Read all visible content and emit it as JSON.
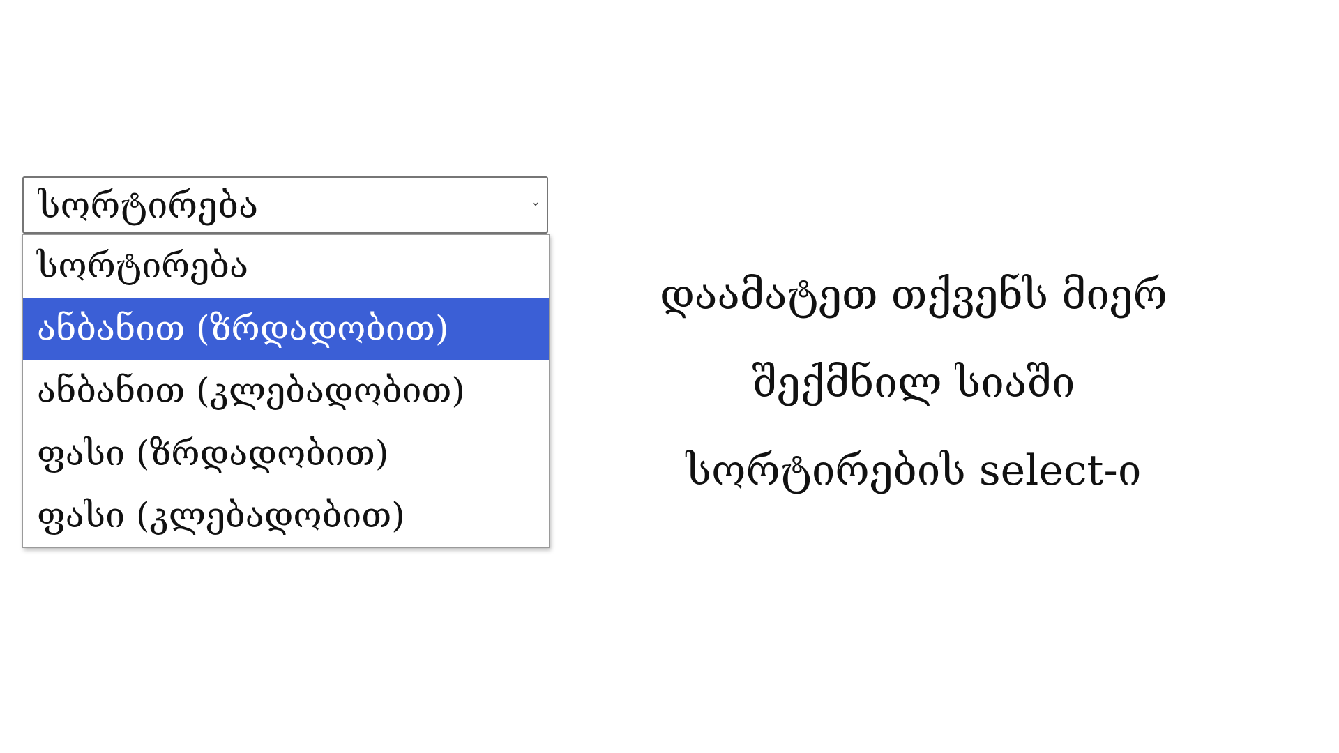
{
  "select": {
    "value": "სორტირება",
    "arrow_icon": "chevron-down-icon"
  },
  "dropdown": {
    "options": [
      {
        "label": "სორტირება",
        "selected": false
      },
      {
        "label": "ანბანით (ზრდადობით)",
        "selected": true
      },
      {
        "label": "ანბანით (კლებადობით)",
        "selected": false
      },
      {
        "label": "ფასი (ზრდადობით)",
        "selected": false
      },
      {
        "label": "ფასი (კლებადობით)",
        "selected": false
      }
    ]
  },
  "caption": {
    "line1": "დაამატეთ თქვენს მიერ",
    "line2": "შექმნილ სიაში",
    "line3": "სორტირების select-ი"
  },
  "colors": {
    "highlight": "#3b5fd6",
    "highlight_text": "#ffffff",
    "border": "#767676",
    "text": "#111111"
  }
}
